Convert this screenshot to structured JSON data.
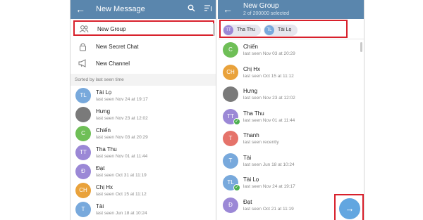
{
  "left_screen": {
    "title": "New Message",
    "icons": {
      "back": "back-arrow-icon",
      "search": "search-icon",
      "sort": "sort-icon"
    },
    "menu": [
      {
        "label": "New Group",
        "icon": "group-icon"
      },
      {
        "label": "New Secret Chat",
        "icon": "lock-icon"
      },
      {
        "label": "New Channel",
        "icon": "megaphone-icon"
      }
    ],
    "section_label": "Sorted by last seen time",
    "contacts": [
      {
        "initials": "TL",
        "name": "Tài Lọ",
        "status": "last seen Nov 24 at 19:17",
        "color": "#78a9dc"
      },
      {
        "initials": "",
        "name": "Hưng",
        "status": "last seen Nov 23 at 12:02",
        "color": "#7a7a7a"
      },
      {
        "initials": "C",
        "name": "Chiến",
        "status": "last seen Nov 03 at 20:29",
        "color": "#6fbf57"
      },
      {
        "initials": "TT",
        "name": "Tha Thu",
        "status": "last seen Nov 01 at 11:44",
        "color": "#9b88d6"
      },
      {
        "initials": "Đ",
        "name": "Đạt",
        "status": "last seen Oct 31 at 11:19",
        "color": "#9b88d6"
      },
      {
        "initials": "CH",
        "name": "Chị Hx",
        "status": "last seen Oct 15 at 11:12",
        "color": "#e9a23b"
      },
      {
        "initials": "T",
        "name": "Tài",
        "status": "last seen Jun 18 at 10:24",
        "color": "#78a9dc"
      }
    ]
  },
  "right_screen": {
    "title": "New Group",
    "subtitle": "2 of 200000 selected",
    "icons": {
      "back": "back-arrow-icon",
      "next": "arrow-right-icon"
    },
    "selected_chips": [
      {
        "initials": "TT",
        "name": "Tha Thu",
        "color": "#9b88d6"
      },
      {
        "initials": "TL",
        "name": "Tài Lọ",
        "color": "#78a9dc"
      }
    ],
    "contacts": [
      {
        "initials": "C",
        "name": "Chiến",
        "status": "last seen Nov 03 at 20:29",
        "color": "#6fbf57",
        "selected": false
      },
      {
        "initials": "CH",
        "name": "Chị Hx",
        "status": "last seen Oct 15 at 11:12",
        "color": "#e9a23b",
        "selected": false
      },
      {
        "initials": "",
        "name": "Hưng",
        "status": "last seen Nov 23 at 12:02",
        "color": "#7a7a7a",
        "selected": false
      },
      {
        "initials": "TT",
        "name": "Tha Thu",
        "status": "last seen Nov 01 at 11:44",
        "color": "#9b88d6",
        "selected": true
      },
      {
        "initials": "T",
        "name": "Thanh",
        "status": "last seen recently",
        "color": "#e5736a",
        "selected": false
      },
      {
        "initials": "T",
        "name": "Tài",
        "status": "last seen Jun 18 at 10:24",
        "color": "#78a9dc",
        "selected": false
      },
      {
        "initials": "TL",
        "name": "Tài Lọ",
        "status": "last seen Nov 24 at 19:17",
        "color": "#78a9dc",
        "selected": true
      },
      {
        "initials": "Đ",
        "name": "Đạt",
        "status": "last seen Oct 21 at 11:19",
        "color": "#9b88d6",
        "selected": false
      }
    ]
  },
  "colors": {
    "appbar": "#5a86ad",
    "highlight": "#d8202b",
    "fab": "#62a6e0"
  }
}
